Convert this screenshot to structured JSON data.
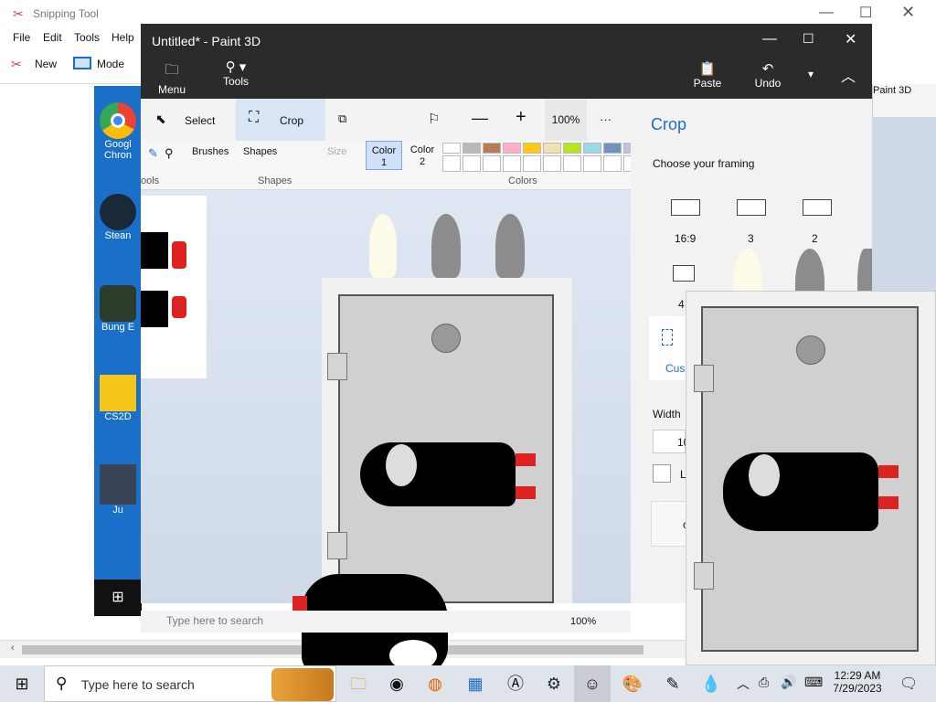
{
  "snipping_tool": {
    "title": "Snipping Tool",
    "menu": [
      "File",
      "Edit",
      "Tools",
      "Help"
    ],
    "new_label": "New",
    "mode_label": "Mode"
  },
  "desktop_icons": [
    {
      "label": "Googl Chron"
    },
    {
      "label": "Stean"
    },
    {
      "label": "Bung E"
    },
    {
      "label": "CS2D"
    },
    {
      "label": "Ju"
    }
  ],
  "paint3d": {
    "title": "Untitled* - Paint 3D",
    "top_buttons": {
      "menu": "Menu",
      "tools": "Tools",
      "paste": "Paste",
      "undo": "Undo"
    },
    "toolbar": {
      "select": "Select",
      "crop": "Crop",
      "zoom": "100%",
      "more": "···"
    },
    "ribbon": {
      "tools_group": "ools",
      "brushes": "Brushes",
      "shapes": "Shapes",
      "shapes_group": "Shapes",
      "size": "Size",
      "color1": "Color\n1",
      "color2": "Color\n2",
      "colors_group": "Colors"
    },
    "palette": [
      "#ffffff",
      "#b9b9b9",
      "#b97a57",
      "#ffaec9",
      "#ffc90e",
      "#efe4b0",
      "#b5e61d",
      "#99d9ea",
      "#7092be",
      "#c8bfe7"
    ],
    "status": {
      "zoom": "100%",
      "search_ghost": "Type here to search"
    },
    "side_panel": {
      "title": "Crop",
      "framing_label": "Choose your framing",
      "ratios": [
        "16:9",
        "3",
        "2",
        "4"
      ],
      "custom_label": "Cus",
      "width_label": "Width",
      "width_value": "10",
      "lock_label": "L",
      "ok_label": "c"
    },
    "behind_label": "Paint 3D"
  },
  "taskbar": {
    "search_placeholder": "Type here to search",
    "time": "12:29 AM",
    "date": "7/29/2023"
  }
}
